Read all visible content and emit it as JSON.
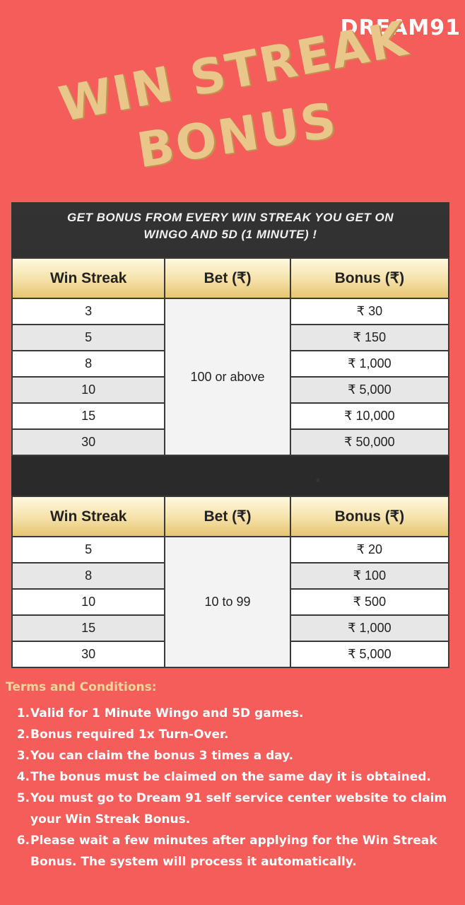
{
  "brand": {
    "logo": "DREAM91"
  },
  "headline": {
    "line1": "Win Streak",
    "line2": "Bonus"
  },
  "board": {
    "message": "Get bonus from every win streak you get on Wingo and 5D (1 minute) !"
  },
  "table1": {
    "headers": [
      "Win Streak",
      "Bet (₹)",
      "Bonus (₹)"
    ],
    "bet": "100 or above",
    "rows": [
      {
        "streak": "3",
        "bonus": "₹ 30"
      },
      {
        "streak": "5",
        "bonus": "₹ 150"
      },
      {
        "streak": "8",
        "bonus": "₹ 1,000"
      },
      {
        "streak": "10",
        "bonus": "₹ 5,000"
      },
      {
        "streak": "15",
        "bonus": "₹ 10,000"
      },
      {
        "streak": "30",
        "bonus": "₹ 50,000"
      }
    ]
  },
  "table2": {
    "headers": [
      "Win Streak",
      "Bet (₹)",
      "Bonus (₹)"
    ],
    "bet": "10 to 99",
    "rows": [
      {
        "streak": "5",
        "bonus": "₹ 20"
      },
      {
        "streak": "8",
        "bonus": "₹ 100"
      },
      {
        "streak": "10",
        "bonus": "₹ 500"
      },
      {
        "streak": "15",
        "bonus": "₹ 1,000"
      },
      {
        "streak": "30",
        "bonus": "₹ 5,000"
      }
    ]
  },
  "terms": {
    "title": "Terms and Conditions:",
    "items": [
      {
        "num": "1.",
        "text": "Valid for 1 Minute Wingo and 5D games."
      },
      {
        "num": "2.",
        "text": "Bonus required 1x Turn-Over."
      },
      {
        "num": "3.",
        "text": "You can claim the bonus 3 times a day."
      },
      {
        "num": "4.",
        "text": "The bonus must be claimed on the same day it is obtained."
      },
      {
        "num": "5.",
        "text": "You must go to Dream 91 self service center website to claim your Win Streak Bonus."
      },
      {
        "num": "6.",
        "text": "Please wait a few minutes after applying for the Win Streak Bonus. The system will process it automatically."
      }
    ]
  }
}
